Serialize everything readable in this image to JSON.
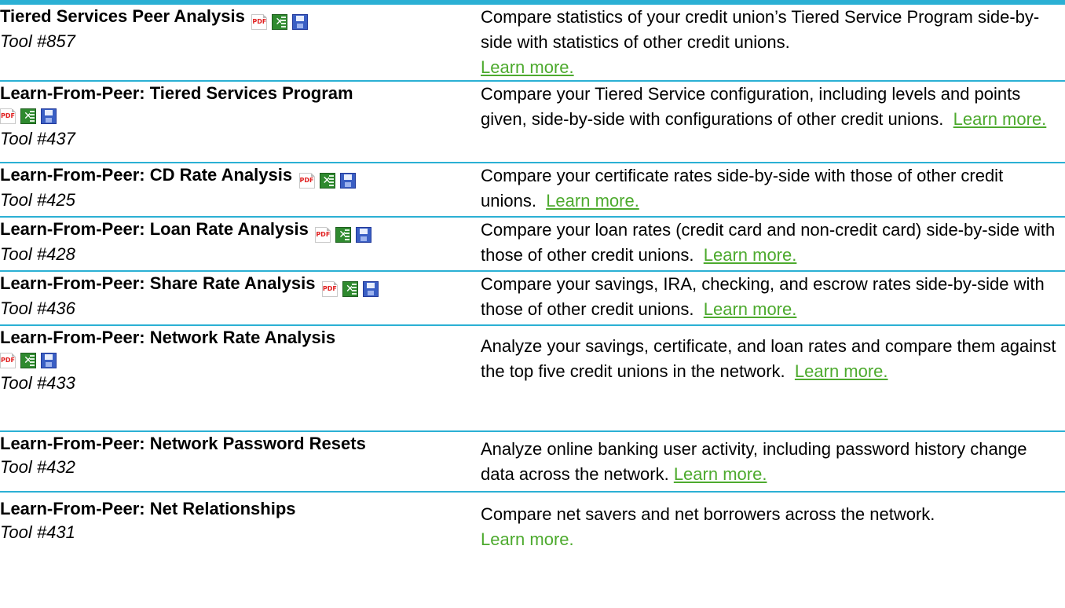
{
  "rows": [
    {
      "title": "Tiered Services Peer Analysis",
      "tool": "Tool #857",
      "desc": "Compare statistics of your credit union’s Tiered Service Program side-by-side with statistics of other credit unions.",
      "link": "Learn more."
    },
    {
      "title": "Learn-From-Peer: Tiered Services Program",
      "tool": "Tool #437",
      "desc": "Compare your Tiered Service configuration, including levels and points given, side-by-side with configurations of other credit unions.",
      "link": "Learn more."
    },
    {
      "title": "Learn-From-Peer: CD Rate Analysis",
      "tool": "Tool #425",
      "desc": "Compare your certificate rates side-by-side with those of other credit unions.",
      "link": "Learn more."
    },
    {
      "title": "Learn-From-Peer: Loan Rate Analysis",
      "tool": "Tool #428",
      "desc": "Compare your loan rates (credit card and non-credit card) side-by-side with those of other credit unions.",
      "link": "Learn more."
    },
    {
      "title": "Learn-From-Peer: Share Rate Analysis",
      "tool": "Tool #436",
      "desc": "Compare your savings, IRA, checking, and escrow rates side-by-side with those of other credit unions.",
      "link": "Learn more."
    },
    {
      "title": "Learn-From-Peer: Network Rate Analysis",
      "tool": "Tool #433",
      "desc": "Analyze your savings, certificate, and loan rates and compare them against the top five credit unions in the network.",
      "link": "Learn more."
    },
    {
      "title": "Learn-From-Peer: Network Password Resets",
      "tool": "Tool #432",
      "desc": "Analyze online banking user activity, including password history change data across the network.",
      "link": "Learn more."
    },
    {
      "title": "Learn-From-Peer: Net Relationships",
      "tool": "Tool #431",
      "desc": "Compare net savers and net borrowers across the network.",
      "link": "Learn more."
    }
  ],
  "icons": {
    "pdf": "PDF",
    "excel": "excel-icon",
    "save": "save-icon",
    "accent": "#2bb0d4",
    "link_color": "#4daa2e"
  }
}
